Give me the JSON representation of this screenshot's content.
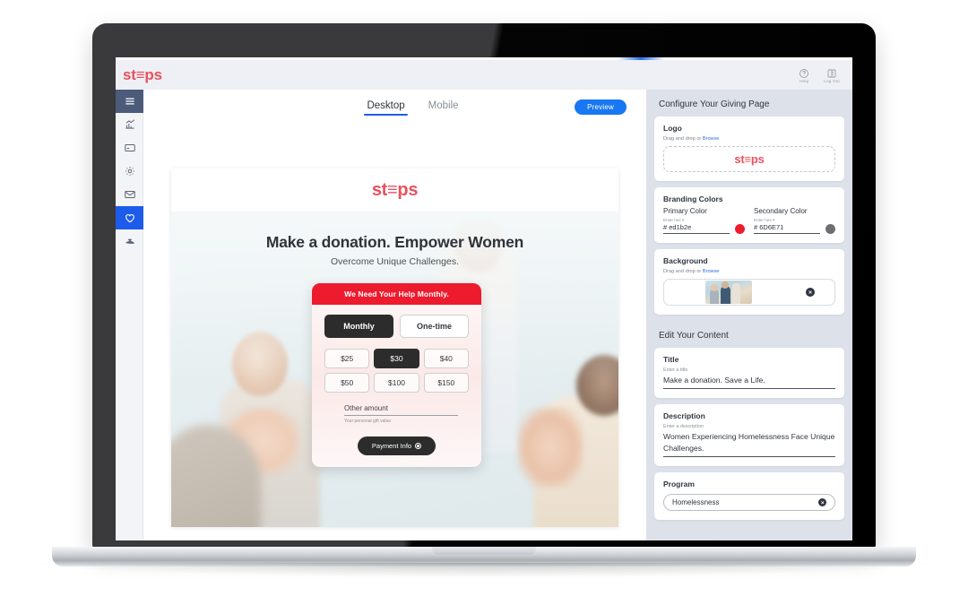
{
  "app": {
    "brand_logo": "st≡ps",
    "header_actions": [
      {
        "label": "Help",
        "icon": "help-circle-icon"
      },
      {
        "label": "Log Out",
        "icon": "logout-icon"
      }
    ]
  },
  "sidebar": {
    "items": [
      {
        "name": "menu",
        "icon": "hamburger-menu-icon",
        "active": false
      },
      {
        "name": "analytics",
        "icon": "chart-bar-icon",
        "active": false
      },
      {
        "name": "payments",
        "icon": "card-icon",
        "active": false
      },
      {
        "name": "settings",
        "icon": "gear-icon",
        "active": false
      },
      {
        "name": "messages",
        "icon": "envelope-icon",
        "active": false
      },
      {
        "name": "giving",
        "icon": "heart-icon",
        "active": true
      },
      {
        "name": "donate",
        "icon": "hand-heart-icon",
        "active": false
      }
    ]
  },
  "preview": {
    "tabs": [
      {
        "label": "Desktop",
        "active": true
      },
      {
        "label": "Mobile",
        "active": false
      }
    ],
    "preview_button": "Preview",
    "page": {
      "logo": "st≡ps",
      "hero_title": "Make a donation. Empower Women",
      "hero_subtitle": "Overcome Unique Challenges.",
      "widget": {
        "banner": "We Need Your Help Monthly.",
        "frequencies": [
          {
            "label": "Monthly",
            "selected": true
          },
          {
            "label": "One-time",
            "selected": false
          }
        ],
        "amounts": [
          {
            "label": "$25",
            "selected": false
          },
          {
            "label": "$30",
            "selected": true
          },
          {
            "label": "$40",
            "selected": false
          },
          {
            "label": "$50",
            "selected": false
          },
          {
            "label": "$100",
            "selected": false
          },
          {
            "label": "$150",
            "selected": false
          }
        ],
        "other_amount_label": "Other amount",
        "other_amount_hint": "Your personal gift value",
        "payment_button": "Payment Info"
      }
    }
  },
  "config": {
    "section_title": "Configure Your Giving Page",
    "logo_card": {
      "title": "Logo",
      "dnd_prefix": "Drag and drop or ",
      "browse": "Browse",
      "logo_text": "st≡ps"
    },
    "branding_card": {
      "title": "Branding Colors",
      "primary": {
        "label": "Primary Color",
        "hint": "Enter hex #",
        "value": "#  ed1b2e",
        "color": "#ed1b2e"
      },
      "secondary": {
        "label": "Secondary Color",
        "hint": "Enter hex #",
        "value": "#  6D6E71",
        "color": "#6D6E71"
      }
    },
    "background_card": {
      "title": "Background",
      "dnd_prefix": "Drag and drop or ",
      "browse": "Browse"
    },
    "content_section_title": "Edit Your Content",
    "title_card": {
      "title": "Title",
      "hint": "Enter a title",
      "value": "Make a donation. Save a Life."
    },
    "description_card": {
      "title": "Description",
      "hint": "Enter a description",
      "value": "Women Experiencing Homelessness Face Unique Challenges."
    },
    "program_card": {
      "title": "Program",
      "value": "Homelessness"
    }
  },
  "colors": {
    "accent_blue": "#1d5bea",
    "brand_red": "#ed1b2e",
    "logo_red": "#e8525f",
    "rail_dark": "#4c5b7a",
    "panel_bg": "#dde1ea"
  }
}
